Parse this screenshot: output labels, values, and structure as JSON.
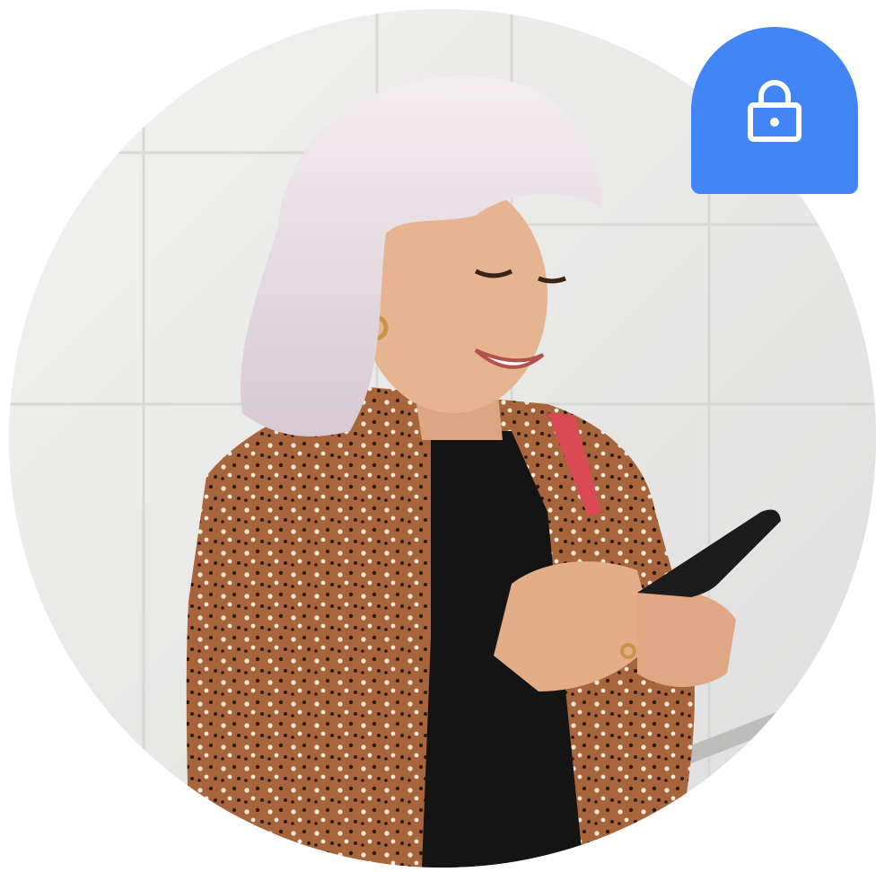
{
  "image": {
    "subject": "person-with-phone-photo",
    "shape": "circle"
  },
  "badge": {
    "icon": "lock-icon",
    "color": "#4285f4"
  },
  "colors": {
    "wall": "#e9e9e7",
    "hair": "#e7dfe4",
    "skin": "#e6b48f",
    "jacket": "#a5623a",
    "top": "#141414",
    "phone": "#1c1c1c",
    "strap": "#d94a55"
  }
}
